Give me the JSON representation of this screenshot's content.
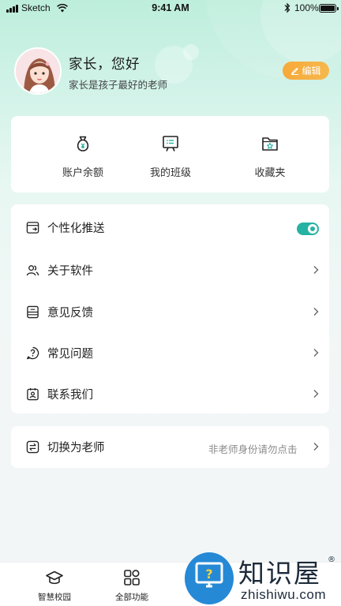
{
  "status_bar": {
    "carrier": "Sketch",
    "time": "9:41 AM",
    "battery": "100%"
  },
  "profile": {
    "name": "家长，您好",
    "motto": "家长是孩子最好的老师",
    "edit_label": "编辑"
  },
  "quick_actions": [
    {
      "label": "账户余额",
      "icon": "money-bag-icon"
    },
    {
      "label": "我的班级",
      "icon": "whiteboard-icon"
    },
    {
      "label": "收藏夹",
      "icon": "star-folder-icon"
    }
  ],
  "menu": {
    "items": [
      {
        "label": "个性化推送",
        "icon": "push-icon",
        "control": "toggle",
        "toggle_on": true
      },
      {
        "label": "关于软件",
        "icon": "users-icon",
        "control": "chevron"
      },
      {
        "label": "意见反馈",
        "icon": "feedback-icon",
        "control": "chevron"
      },
      {
        "label": "常见问题",
        "icon": "question-icon",
        "control": "chevron"
      },
      {
        "label": "联系我们",
        "icon": "contact-icon",
        "control": "chevron"
      }
    ]
  },
  "switch_role": {
    "label": "切换为老师",
    "hint": "非老师身份请勿点击"
  },
  "tabbar": {
    "items": [
      {
        "label": "智慧校园",
        "icon": "school-cap-icon"
      },
      {
        "label": "全部功能",
        "icon": "grid-icon"
      }
    ]
  },
  "watermark": {
    "text": "知识屋",
    "url": "zhishiwu.com",
    "reg_mark": "®"
  },
  "colors": {
    "accent": "#26b2a2",
    "edit_button": "#f7a93a",
    "header_gradient_top": "#bdeedc",
    "watermark_blue": "#2689d6"
  }
}
